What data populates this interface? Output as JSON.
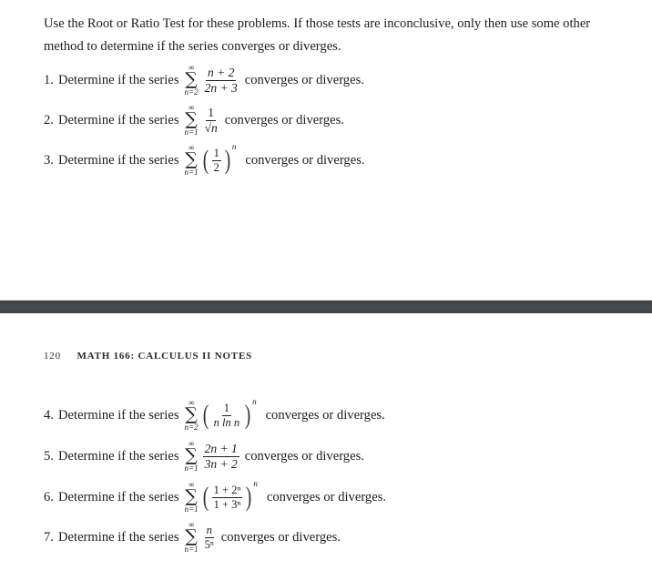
{
  "intro": "Use the Root or Ratio Test for these problems. If those tests are inconclusive, only then use some other method to determine if the series converges or diverges.",
  "running_head": {
    "page_number": "120",
    "title": "MATH 166: CALCULUS II NOTES"
  },
  "common": {
    "lead": "Determine if the series",
    "tail": "converges or diverges.",
    "infinity": "∞",
    "sigma": "∑"
  },
  "problems": [
    {
      "number": "1.",
      "lower": "n=2",
      "term": "(n+2)/(2n+3)",
      "numerator": "n + 2",
      "denominator": "2n + 3"
    },
    {
      "number": "2.",
      "lower": "n=1",
      "term": "1/√n",
      "numerator": "1",
      "denominator": "√n"
    },
    {
      "number": "3.",
      "lower": "n=1",
      "term": "(1/2)^n",
      "numerator": "1",
      "denominator": "2",
      "exponent": "n"
    },
    {
      "number": "4.",
      "lower": "n=2",
      "term": "(1/(n ln n))^n",
      "numerator": "1",
      "denominator": "n ln n",
      "exponent": "n"
    },
    {
      "number": "5.",
      "lower": "n=1",
      "term": "(2n+1)/(3n+2)",
      "numerator": "2n + 1",
      "denominator": "3n + 2"
    },
    {
      "number": "6.",
      "lower": "n=1",
      "term": "((1+2^n)/(1+3^n))^n",
      "numerator": "1 + 2ⁿ",
      "denominator": "1 + 3ⁿ",
      "exponent": "n"
    },
    {
      "number": "7.",
      "lower": "n=1",
      "term": "n/5^n",
      "numerator": "n",
      "denominator": "5ⁿ"
    }
  ]
}
